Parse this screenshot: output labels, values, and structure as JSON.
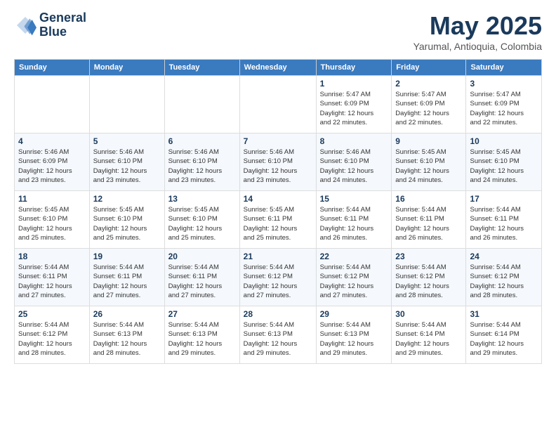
{
  "logo": {
    "line1": "General",
    "line2": "Blue"
  },
  "title": "May 2025",
  "subtitle": "Yarumal, Antioquia, Colombia",
  "header_days": [
    "Sunday",
    "Monday",
    "Tuesday",
    "Wednesday",
    "Thursday",
    "Friday",
    "Saturday"
  ],
  "weeks": [
    [
      {
        "day": "",
        "info": ""
      },
      {
        "day": "",
        "info": ""
      },
      {
        "day": "",
        "info": ""
      },
      {
        "day": "",
        "info": ""
      },
      {
        "day": "1",
        "info": "Sunrise: 5:47 AM\nSunset: 6:09 PM\nDaylight: 12 hours\nand 22 minutes."
      },
      {
        "day": "2",
        "info": "Sunrise: 5:47 AM\nSunset: 6:09 PM\nDaylight: 12 hours\nand 22 minutes."
      },
      {
        "day": "3",
        "info": "Sunrise: 5:47 AM\nSunset: 6:09 PM\nDaylight: 12 hours\nand 22 minutes."
      }
    ],
    [
      {
        "day": "4",
        "info": "Sunrise: 5:46 AM\nSunset: 6:09 PM\nDaylight: 12 hours\nand 23 minutes."
      },
      {
        "day": "5",
        "info": "Sunrise: 5:46 AM\nSunset: 6:10 PM\nDaylight: 12 hours\nand 23 minutes."
      },
      {
        "day": "6",
        "info": "Sunrise: 5:46 AM\nSunset: 6:10 PM\nDaylight: 12 hours\nand 23 minutes."
      },
      {
        "day": "7",
        "info": "Sunrise: 5:46 AM\nSunset: 6:10 PM\nDaylight: 12 hours\nand 23 minutes."
      },
      {
        "day": "8",
        "info": "Sunrise: 5:46 AM\nSunset: 6:10 PM\nDaylight: 12 hours\nand 24 minutes."
      },
      {
        "day": "9",
        "info": "Sunrise: 5:45 AM\nSunset: 6:10 PM\nDaylight: 12 hours\nand 24 minutes."
      },
      {
        "day": "10",
        "info": "Sunrise: 5:45 AM\nSunset: 6:10 PM\nDaylight: 12 hours\nand 24 minutes."
      }
    ],
    [
      {
        "day": "11",
        "info": "Sunrise: 5:45 AM\nSunset: 6:10 PM\nDaylight: 12 hours\nand 25 minutes."
      },
      {
        "day": "12",
        "info": "Sunrise: 5:45 AM\nSunset: 6:10 PM\nDaylight: 12 hours\nand 25 minutes."
      },
      {
        "day": "13",
        "info": "Sunrise: 5:45 AM\nSunset: 6:10 PM\nDaylight: 12 hours\nand 25 minutes."
      },
      {
        "day": "14",
        "info": "Sunrise: 5:45 AM\nSunset: 6:11 PM\nDaylight: 12 hours\nand 25 minutes."
      },
      {
        "day": "15",
        "info": "Sunrise: 5:44 AM\nSunset: 6:11 PM\nDaylight: 12 hours\nand 26 minutes."
      },
      {
        "day": "16",
        "info": "Sunrise: 5:44 AM\nSunset: 6:11 PM\nDaylight: 12 hours\nand 26 minutes."
      },
      {
        "day": "17",
        "info": "Sunrise: 5:44 AM\nSunset: 6:11 PM\nDaylight: 12 hours\nand 26 minutes."
      }
    ],
    [
      {
        "day": "18",
        "info": "Sunrise: 5:44 AM\nSunset: 6:11 PM\nDaylight: 12 hours\nand 27 minutes."
      },
      {
        "day": "19",
        "info": "Sunrise: 5:44 AM\nSunset: 6:11 PM\nDaylight: 12 hours\nand 27 minutes."
      },
      {
        "day": "20",
        "info": "Sunrise: 5:44 AM\nSunset: 6:11 PM\nDaylight: 12 hours\nand 27 minutes."
      },
      {
        "day": "21",
        "info": "Sunrise: 5:44 AM\nSunset: 6:12 PM\nDaylight: 12 hours\nand 27 minutes."
      },
      {
        "day": "22",
        "info": "Sunrise: 5:44 AM\nSunset: 6:12 PM\nDaylight: 12 hours\nand 27 minutes."
      },
      {
        "day": "23",
        "info": "Sunrise: 5:44 AM\nSunset: 6:12 PM\nDaylight: 12 hours\nand 28 minutes."
      },
      {
        "day": "24",
        "info": "Sunrise: 5:44 AM\nSunset: 6:12 PM\nDaylight: 12 hours\nand 28 minutes."
      }
    ],
    [
      {
        "day": "25",
        "info": "Sunrise: 5:44 AM\nSunset: 6:12 PM\nDaylight: 12 hours\nand 28 minutes."
      },
      {
        "day": "26",
        "info": "Sunrise: 5:44 AM\nSunset: 6:13 PM\nDaylight: 12 hours\nand 28 minutes."
      },
      {
        "day": "27",
        "info": "Sunrise: 5:44 AM\nSunset: 6:13 PM\nDaylight: 12 hours\nand 29 minutes."
      },
      {
        "day": "28",
        "info": "Sunrise: 5:44 AM\nSunset: 6:13 PM\nDaylight: 12 hours\nand 29 minutes."
      },
      {
        "day": "29",
        "info": "Sunrise: 5:44 AM\nSunset: 6:13 PM\nDaylight: 12 hours\nand 29 minutes."
      },
      {
        "day": "30",
        "info": "Sunrise: 5:44 AM\nSunset: 6:14 PM\nDaylight: 12 hours\nand 29 minutes."
      },
      {
        "day": "31",
        "info": "Sunrise: 5:44 AM\nSunset: 6:14 PM\nDaylight: 12 hours\nand 29 minutes."
      }
    ]
  ]
}
